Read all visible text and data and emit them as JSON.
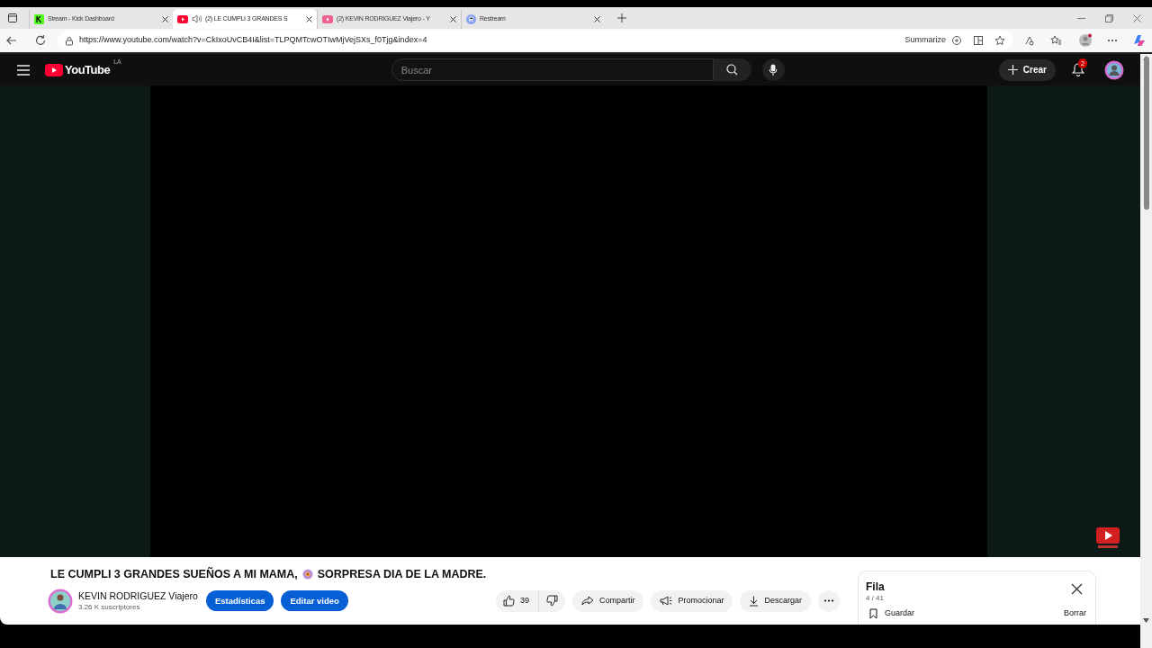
{
  "browser": {
    "tabs": [
      {
        "title": "Stream - Kick Dashboard",
        "kind": "kick",
        "selected": false,
        "audio": false
      },
      {
        "title": "(2) LE CUMPLI 3 GRANDES S",
        "kind": "youtube",
        "selected": true,
        "audio": true
      },
      {
        "title": "(2) KEVIN RODRIGUEZ Viajero - Y",
        "kind": "studio",
        "selected": false,
        "audio": false
      },
      {
        "title": "Restream",
        "kind": "restream",
        "selected": false,
        "audio": false
      }
    ],
    "url": "https://www.youtube.com/watch?v=CkIxoUvCB4I&list=TLPQMTcwOTIwMjVejSXs_f0Tjg&index=4",
    "summarize": "Summarize"
  },
  "header": {
    "logo_text": "YouTube",
    "logo_region": "LA",
    "search": {
      "placeholder": "Buscar"
    },
    "create": "Crear",
    "notifications": "2"
  },
  "video": {
    "title_start": "LE CUMPLI 3 GRANDES SUEÑOS A MI MAMA,",
    "title_end": "SORPRESA DIA DE LA MADRE.",
    "channel": "KEVIN RODRIGUEZ Viajero",
    "subscribers": "3.26 K suscriptores",
    "owner_buttons": [
      "Estadísticas",
      "Editar video"
    ],
    "likes": "39",
    "actions": [
      {
        "kind": "share",
        "label": "Compartir"
      },
      {
        "kind": "promote",
        "label": "Promocionar"
      },
      {
        "kind": "download",
        "label": "Descargar"
      }
    ]
  },
  "queue": {
    "title": "Fila",
    "position": "4 / 41",
    "save": "Guardar",
    "clear": "Borrar"
  }
}
